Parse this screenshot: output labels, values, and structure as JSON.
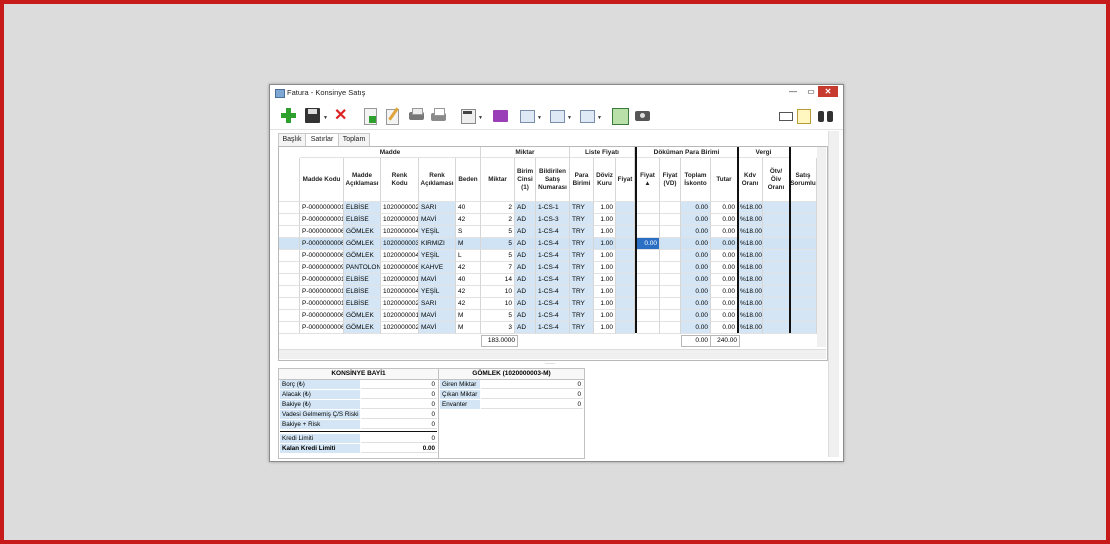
{
  "window": {
    "title": "Fatura - Konsinye Satış",
    "min": "—",
    "max": "▭",
    "close": "✕"
  },
  "toolbar": {
    "icons": [
      "add-icon",
      "save-icon",
      "delete-icon",
      "new-document-icon",
      "edit-icon",
      "print-preview-icon",
      "print-icon",
      "calculator-icon",
      "folder-icon",
      "report-icon",
      "report2-icon",
      "report3-icon",
      "grid-icon",
      "camera-icon",
      "message-icon",
      "note-icon",
      "binoculars-icon"
    ]
  },
  "tabs": [
    "Başlık",
    "Satırlar",
    "Toplam"
  ],
  "grid": {
    "groups": {
      "madde": "Madde",
      "miktar": "Miktar",
      "liste": "Liste Fiyatı",
      "dokuman": "Döküman Para Birimi",
      "vergi": "Vergi"
    },
    "columns": {
      "madde_kodu": "Madde Kodu",
      "madde_aciklamasi": "Madde Açıklaması",
      "renk_kodu": "Renk Kodu",
      "renk_aciklamasi": "Renk Açıklaması",
      "beden": "Beden",
      "miktar": "Miktar",
      "birim_cinsi": "Birim Cinsi (1)",
      "bildirilen": "Bildirilen Satış Numarası",
      "para_birimi": "Para Birimi",
      "doviz_kuru": "Döviz Kuru",
      "fiyat": "Fiyat",
      "fiyat2": "Fiyat ▲",
      "fiyat_vd": "Fiyat (VD)",
      "toplam_iskonto": "Toplam İskonto",
      "tutar": "Tutar",
      "kdv": "Kdv Oranı",
      "otv": "Ötv/Öiv Oranı",
      "satis": "Satış Sorumlu"
    },
    "rows": [
      [
        "P-0000000001",
        "ELBİSE",
        "1020000002",
        "SARI",
        "40",
        "2",
        "AD",
        "1-CS-1",
        "TRY",
        "1.00",
        "",
        "",
        "",
        "0.00",
        "0.00",
        "%18.00"
      ],
      [
        "P-0000000001",
        "ELBİSE",
        "1020000001",
        "MAVİ",
        "42",
        "2",
        "AD",
        "1-CS-3",
        "TRY",
        "1.00",
        "",
        "",
        "",
        "0.00",
        "0.00",
        "%18.00"
      ],
      [
        "P-0000000006",
        "GÖMLEK",
        "1020000004",
        "YEŞİL",
        "S",
        "5",
        "AD",
        "1-CS-4",
        "TRY",
        "1.00",
        "",
        "",
        "",
        "0.00",
        "0.00",
        "%18.00"
      ],
      [
        "P-0000000006",
        "GÖMLEK",
        "1020000003",
        "KIRMIZI",
        "M",
        "5",
        "AD",
        "1-CS-4",
        "TRY",
        "1.00",
        "",
        "0.00",
        "",
        "0.00",
        "0.00",
        "%18.00"
      ],
      [
        "P-0000000006",
        "GÖMLEK",
        "1020000004",
        "YEŞİL",
        "L",
        "5",
        "AD",
        "1-CS-4",
        "TRY",
        "1.00",
        "",
        "",
        "",
        "0.00",
        "0.00",
        "%18.00"
      ],
      [
        "P-0000000009",
        "PANTOLON",
        "1020000006",
        "KAHVE",
        "42",
        "7",
        "AD",
        "1-CS-4",
        "TRY",
        "1.00",
        "",
        "",
        "",
        "0.00",
        "0.00",
        "%18.00"
      ],
      [
        "P-0000000001",
        "ELBİSE",
        "1020000001",
        "MAVİ",
        "40",
        "14",
        "AD",
        "1-CS-4",
        "TRY",
        "1.00",
        "",
        "",
        "",
        "0.00",
        "0.00",
        "%18.00"
      ],
      [
        "P-0000000001",
        "ELBİSE",
        "1020000004",
        "YEŞİL",
        "42",
        "10",
        "AD",
        "1-CS-4",
        "TRY",
        "1.00",
        "",
        "",
        "",
        "0.00",
        "0.00",
        "%18.00"
      ],
      [
        "P-0000000001",
        "ELBİSE",
        "1020000002",
        "SARI",
        "42",
        "10",
        "AD",
        "1-CS-4",
        "TRY",
        "1.00",
        "",
        "",
        "",
        "0.00",
        "0.00",
        "%18.00"
      ],
      [
        "P-0000000006",
        "GÖMLEK",
        "1020000001",
        "MAVİ",
        "M",
        "5",
        "AD",
        "1-CS-4",
        "TRY",
        "1.00",
        "",
        "",
        "",
        "0.00",
        "0.00",
        "%18.00"
      ],
      [
        "P-0000000006",
        "GÖMLEK",
        "1020000002",
        "MAVİ",
        "M",
        "3",
        "AD",
        "1-CS-4",
        "TRY",
        "1.00",
        "",
        "",
        "",
        "0.00",
        "0.00",
        "%18.00"
      ]
    ],
    "footer": {
      "miktar_total": "183.0000",
      "iskonto_total": "0.00",
      "tutar_total": "240.00"
    }
  },
  "left_panel": {
    "title": "KONSİNYE BAYİ1",
    "rows": [
      {
        "label": "Borç (₺)",
        "value": "0"
      },
      {
        "label": "Alacak (₺)",
        "value": "0"
      },
      {
        "label": "Bakiye (₺)",
        "value": "0"
      },
      {
        "label": "Vadesi Gelmemiş Ç/S Riski",
        "value": "0"
      },
      {
        "label": "Bakiye + Risk",
        "value": "0"
      },
      {
        "label": "Kredi Limiti",
        "value": "0"
      },
      {
        "label": "Kalan Kredi Limiti",
        "value": "0.00"
      }
    ]
  },
  "right_panel": {
    "title": "GÖMLEK (1020000003-M)",
    "rows": [
      {
        "label": "Giren Miktar",
        "value": "0"
      },
      {
        "label": "Çıkan Miktar",
        "value": "0"
      },
      {
        "label": "Envanter",
        "value": "0"
      }
    ]
  },
  "colors": {
    "accent_red": "#c71a1a",
    "cell_blue": "#d4e6f5",
    "selected_row": "#cfe3f4"
  }
}
